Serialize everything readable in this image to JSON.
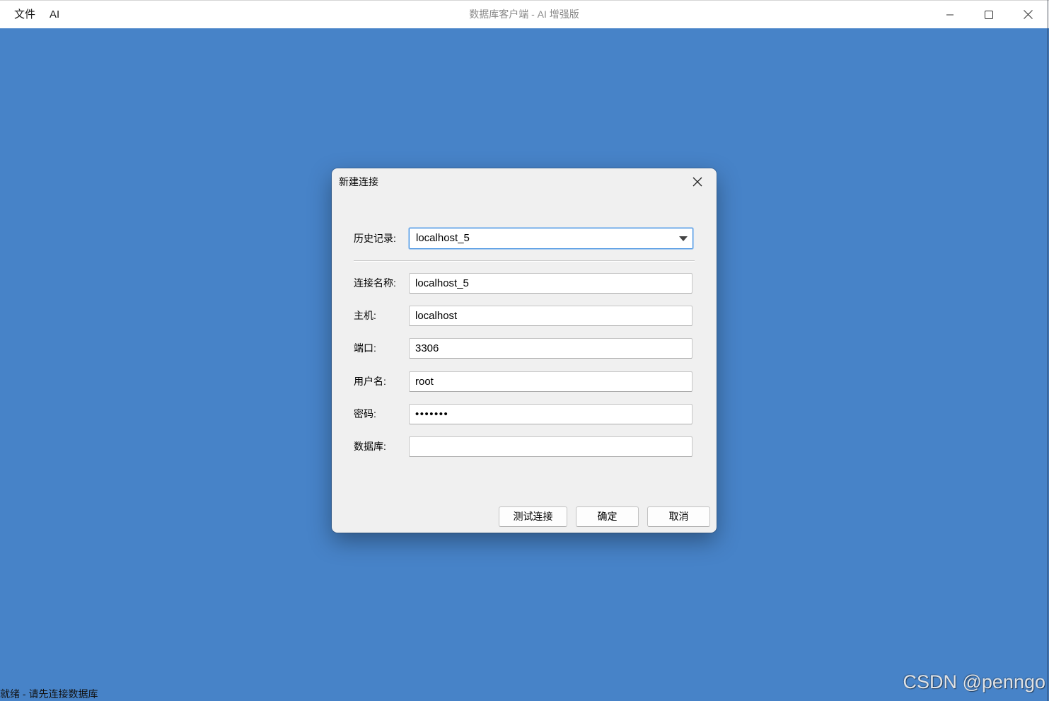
{
  "window": {
    "menu": [
      {
        "label": "文件"
      },
      {
        "label": "AI"
      }
    ],
    "title": "数据库客户端 - AI 增强版",
    "controls": {
      "minimize": "minimize-icon",
      "maximize": "maximize-icon",
      "close": "close-icon"
    }
  },
  "dialog": {
    "title": "新建连接",
    "close_icon": "close-icon",
    "history": {
      "label": "历史记录:",
      "value": "localhost_5",
      "icon": "chevron-down-icon"
    },
    "connection_name": {
      "label": "连接名称:",
      "value": "localhost_5"
    },
    "host": {
      "label": "主机:",
      "value": "localhost"
    },
    "port": {
      "label": "端口:",
      "value": "3306"
    },
    "username": {
      "label": "用户名:",
      "value": "root"
    },
    "password": {
      "label": "密码:",
      "value": "•••••••"
    },
    "database": {
      "label": "数据库:",
      "value": ""
    },
    "buttons": {
      "test": "测试连接",
      "ok": "确定",
      "cancel": "取消"
    }
  },
  "status_bar": {
    "text": "就绪 - 请先连接数据库"
  },
  "watermark": "CSDN @penngo",
  "colors": {
    "desktop": "#4783c8",
    "dialog_bg": "#f0f0f0",
    "focus_border": "#3f8ee0",
    "title_text": "#8a8a8a"
  }
}
